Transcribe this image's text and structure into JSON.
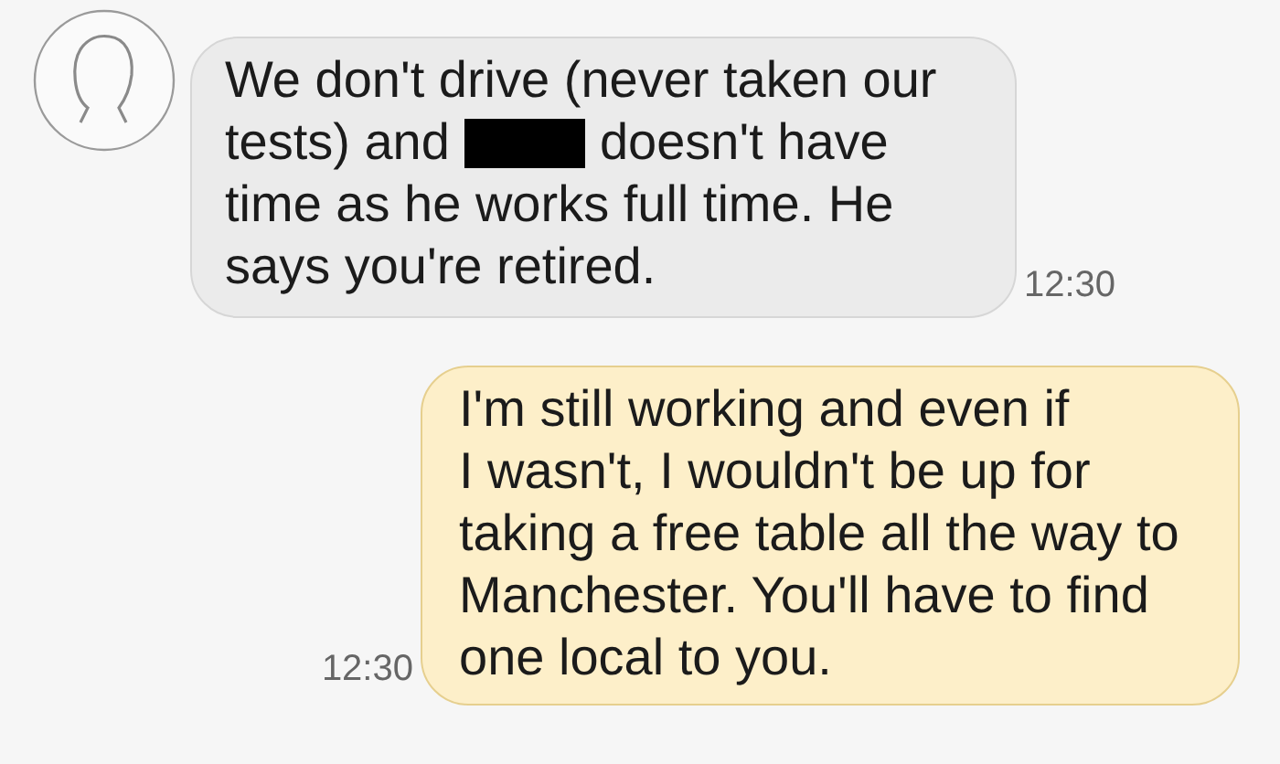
{
  "messages": [
    {
      "kind": "incoming",
      "lines": [
        {
          "text": "We don't drive (never taken our",
          "redacted": false
        },
        {
          "text": "tests) and",
          "redacted": true,
          "text_after": "doesn't have"
        },
        {
          "text": "time as he works full time. He",
          "redacted": false
        },
        {
          "text": "says you're retired.",
          "redacted": false
        }
      ],
      "time": "12:30"
    },
    {
      "kind": "outgoing",
      "text": "I'm still working and even if\nI wasn't, I wouldn't be up for\ntaking a free table all the way to\nManchester. You'll have to find\none local to you.",
      "time": "12:30"
    }
  ]
}
